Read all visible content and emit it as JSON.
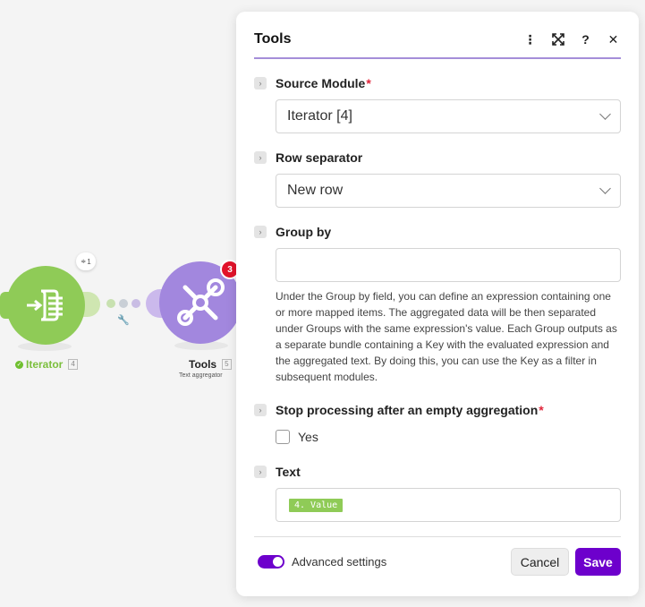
{
  "canvas": {
    "iterator": {
      "label": "Iterator",
      "index": "4",
      "ops_badge": "1",
      "status": "check"
    },
    "tools": {
      "label": "Tools",
      "index": "5",
      "subtitle": "Text aggregator",
      "error_count": "3"
    },
    "connection": {
      "icon": "wrench-icon"
    }
  },
  "panel": {
    "title": "Tools",
    "header_icons": [
      "more-icon",
      "expand-icon",
      "help-icon",
      "close-icon"
    ],
    "fields": {
      "source_module": {
        "label": "Source Module",
        "required": "*",
        "value": "Iterator [4]"
      },
      "row_separator": {
        "label": "Row separator",
        "value": "New row"
      },
      "group_by": {
        "label": "Group by",
        "value": "",
        "help": "Under the Group by field, you can define an expression containing one or more mapped items. The aggregated data will be then separated under Groups with the same expression's value. Each Group outputs as a separate bundle containing a Key with the evaluated expression and the aggregated text. By doing this, you can use the Key as a filter in subsequent modules."
      },
      "stop_processing": {
        "label": "Stop processing after an empty aggregation",
        "required": "*",
        "option": "Yes",
        "checked": false
      },
      "text": {
        "label": "Text",
        "pill": "4. Value"
      }
    },
    "footer": {
      "advanced_label": "Advanced settings",
      "advanced_on": true,
      "cancel": "Cancel",
      "save": "Save"
    }
  },
  "colors": {
    "accent": "#6d00cc",
    "iterator": "#8fcb57",
    "tools": "#a287de",
    "error": "#e2122a"
  }
}
